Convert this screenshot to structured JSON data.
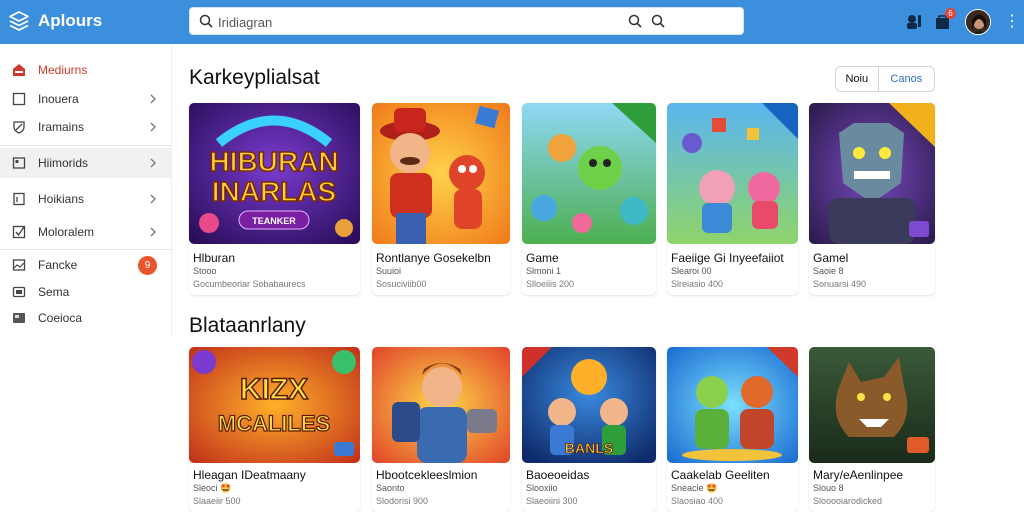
{
  "app": {
    "name": "Aplours",
    "brand_color": "#3b8fdc"
  },
  "search": {
    "value": "Iridiagran",
    "left_icon": "search-icon",
    "right_icons": [
      "search-icon",
      "search-icon"
    ]
  },
  "topbar": {
    "icons": [
      "tools-icon",
      "cart-icon"
    ],
    "cart_badge": "6",
    "avatar": "avatar",
    "menu": "⋮"
  },
  "sidebar": {
    "items": [
      {
        "label": "Mediurns",
        "icon": "home-icon",
        "chevron": false,
        "active": true
      },
      {
        "label": "Inouera",
        "icon": "square-icon",
        "chevron": true
      },
      {
        "label": "Iramains",
        "icon": "shield-icon",
        "chevron": true
      },
      {
        "label": "Hiimorids",
        "icon": "card-icon",
        "chevron": true,
        "selected": true
      },
      {
        "label": "Hoikians",
        "icon": "document-icon",
        "chevron": true
      },
      {
        "label": "Moloralem",
        "icon": "check-box-icon",
        "chevron": true
      },
      {
        "label": "Fancke",
        "icon": "image-icon",
        "badge": "9"
      },
      {
        "label": "Sema",
        "icon": "video-icon"
      },
      {
        "label": "Coeioca",
        "icon": "console-icon"
      }
    ]
  },
  "sections": [
    {
      "title": "Karkeyplialsat",
      "toggle": [
        "Noiu",
        "Canos"
      ],
      "cards": [
        {
          "title": "Hlburan",
          "sub": "Stooo",
          "meta": "Gocumbeoriar Sobabaurecs",
          "art": "hiburan"
        },
        {
          "title": "Rontlanye Gosekelbn",
          "sub": "Suuioi",
          "meta": "Sosuciviib00",
          "art": "plumber"
        },
        {
          "title": "Game",
          "sub": "Slmoni 1",
          "meta": "Slloeiiis 200",
          "art": "green"
        },
        {
          "title": "Faeiige Gi Inyeefaiiot",
          "sub": "Slearoi 00",
          "meta": "Slreiasio 400",
          "art": "pig"
        },
        {
          "title": "Gamel",
          "sub": "Saoie 8",
          "meta": "Sonuarsi 490",
          "art": "robot"
        }
      ]
    },
    {
      "title": "Blataanrlany",
      "cards": [
        {
          "title": "Hleagan IDeatmaany",
          "sub": "Sleoci 🤩",
          "meta": "Slaaeiir 500",
          "art": "kizx"
        },
        {
          "title": "Hbootcekleeslmion",
          "sub": "Saonto",
          "meta": "Slodorisi 900",
          "art": "hero"
        },
        {
          "title": "Baoeoeidas",
          "sub": "Slooxiio",
          "meta": "Slaeoiini 300",
          "art": "kids"
        },
        {
          "title": "Caakelab Geeliten",
          "sub": "Sneacie 🤩",
          "meta": "Slaosiao 400",
          "art": "cats"
        },
        {
          "title": "Mary/eAenlinpee",
          "sub": "Slouo 8",
          "meta": "Slooooiarodicked",
          "art": "wolf"
        }
      ]
    }
  ],
  "thumb_text": {
    "hiburan_line1": "HIBURAN",
    "hiburan_line2": "INARLAS",
    "hiburan_btn": "TEANKER",
    "kizx_line1": "KIZX",
    "kizx_line2": "MCALILES",
    "kids_line": "BANLS"
  }
}
